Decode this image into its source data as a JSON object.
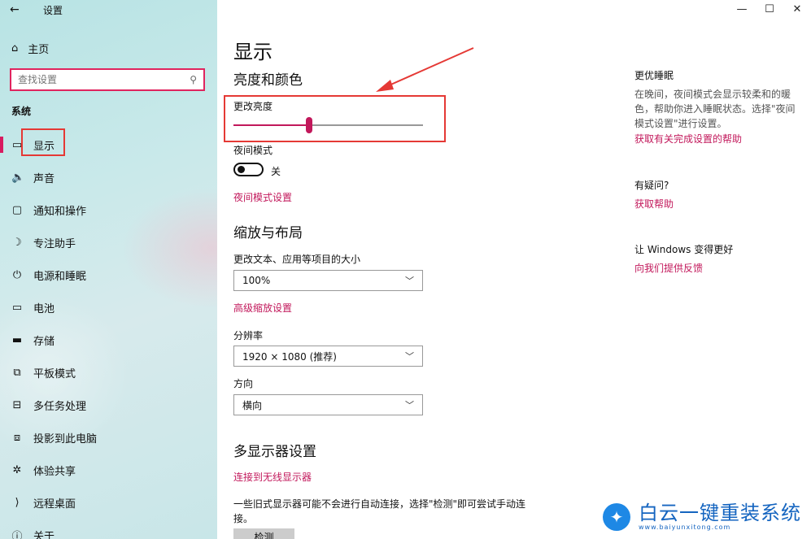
{
  "window": {
    "app_title": "设置",
    "back_icon": "←",
    "minimize_icon": "—",
    "maximize_icon": "☐",
    "close_icon": "✕"
  },
  "sidebar": {
    "home_label": "主页",
    "search_placeholder": "查找设置",
    "section_label": "系统",
    "items": [
      {
        "label": "显示",
        "icon": "display-icon",
        "glyph": "▭"
      },
      {
        "label": "声音",
        "icon": "speaker-icon",
        "glyph": "🔈"
      },
      {
        "label": "通知和操作",
        "icon": "notification-icon",
        "glyph": "▢"
      },
      {
        "label": "专注助手",
        "icon": "moon-icon",
        "glyph": "☽"
      },
      {
        "label": "电源和睡眠",
        "icon": "power-icon",
        "glyph": "⏻"
      },
      {
        "label": "电池",
        "icon": "battery-icon",
        "glyph": "▭"
      },
      {
        "label": "存储",
        "icon": "storage-icon",
        "glyph": "▬"
      },
      {
        "label": "平板模式",
        "icon": "tablet-icon",
        "glyph": "⧉"
      },
      {
        "label": "多任务处理",
        "icon": "multitask-icon",
        "glyph": "⊟"
      },
      {
        "label": "投影到此电脑",
        "icon": "project-icon",
        "glyph": "⧈"
      },
      {
        "label": "体验共享",
        "icon": "share-icon",
        "glyph": "✲"
      },
      {
        "label": "远程桌面",
        "icon": "remote-icon",
        "glyph": "⟩"
      },
      {
        "label": "关于",
        "icon": "info-icon",
        "glyph": "ⓘ"
      }
    ]
  },
  "main": {
    "page_title": "显示",
    "brightness_section": "亮度和颜色",
    "brightness_label": "更改亮度",
    "brightness_value": 0.4,
    "night_mode_label": "夜间模式",
    "night_mode_state": "关",
    "night_mode_link": "夜间模式设置",
    "scale_section": "缩放与布局",
    "scale_label": "更改文本、应用等项目的大小",
    "scale_value": "100%",
    "advanced_scale_link": "高级缩放设置",
    "resolution_label": "分辨率",
    "resolution_value": "1920 × 1080 (推荐)",
    "orientation_label": "方向",
    "orientation_value": "横向",
    "multi_display_section": "多显示器设置",
    "wireless_link": "连接到无线显示器",
    "multi_display_text": "一些旧式显示器可能不会进行自动连接，选择\"检测\"即可尝试手动连接。",
    "detect_button": "检测"
  },
  "right": {
    "sleep_title": "更优睡眠",
    "sleep_text": "在晚间，夜间模式会显示较柔和的暖色，帮助你进入睡眠状态。选择\"夜间模式设置\"进行设置。",
    "sleep_link": "获取有关完成设置的帮助",
    "question_title": "有疑问?",
    "help_link": "获取帮助",
    "improve_title": "让 Windows 变得更好",
    "feedback_link": "向我们提供反馈"
  },
  "watermark": {
    "brand": "白云一键重装系统",
    "url": "www.baiyunxitong.com"
  },
  "colors": {
    "accent": "#c2185b",
    "highlight_box": "#e53935"
  }
}
